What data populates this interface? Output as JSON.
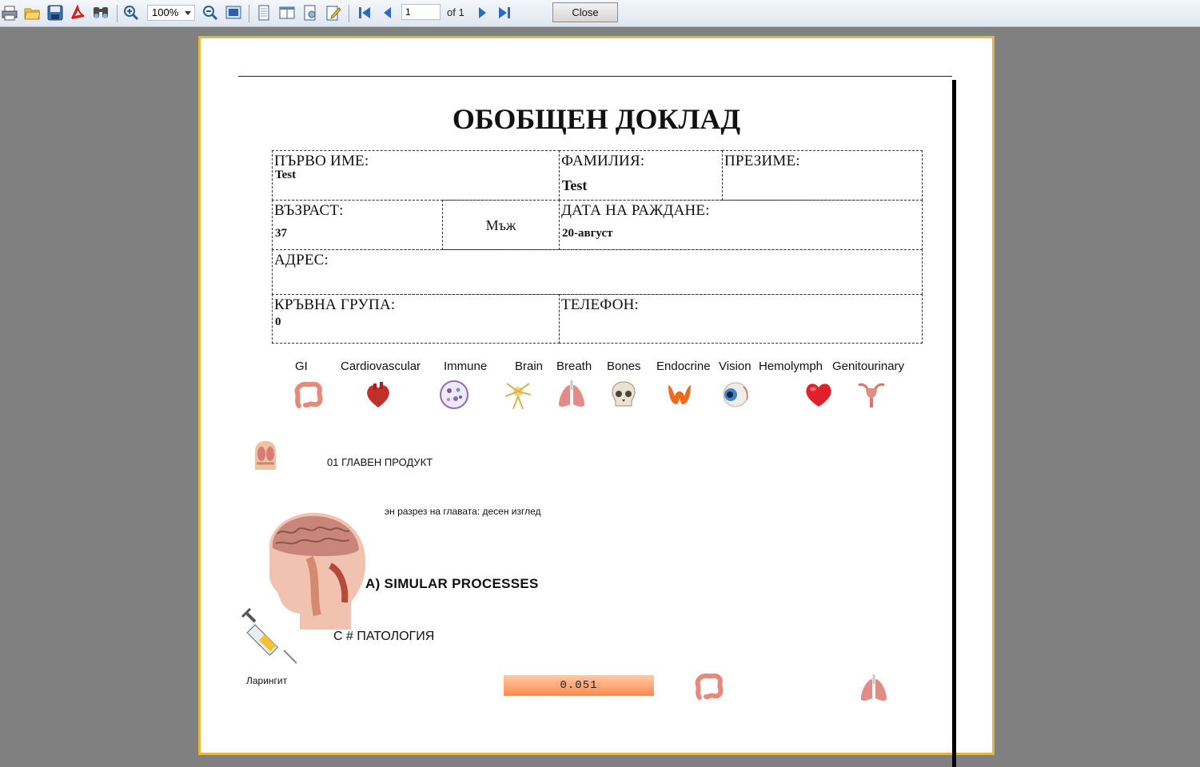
{
  "toolbar": {
    "zoom_value": "100%",
    "page_number": "1",
    "page_of": "of 1",
    "close_label": "Close"
  },
  "report": {
    "title": "ОБОБЩЕН ДОКЛАД",
    "first_name_label": "ПЪРВО ИМЕ:",
    "first_name_value": "Test",
    "last_name_label": "ФАМИЛИЯ:",
    "last_name_value": "Test",
    "patronymic_label": "ПРЕЗИМЕ:",
    "age_label": "ВЪЗРАСТ:",
    "age_value": "37",
    "sex_value": "Мъж",
    "birth_date_label": "ДАТА НА РАЖДАНЕ:",
    "birth_date_value": "20-август",
    "address_label": "АДРЕС:",
    "blood_group_label": "КРЪВНА ГРУПА:",
    "blood_group_value": "0",
    "phone_label": "ТЕЛЕФОН:"
  },
  "categories": [
    "GI",
    "Cardiovascular",
    "Immune",
    "Brain",
    "Breath",
    "Bones",
    "Endocrine",
    "Vision",
    "Hemolymph",
    "Genitourinary"
  ],
  "section": {
    "main_product": "01 ГЛАВЕН ПРОДУКТ",
    "head_section": "эн разрез на главата: десен изглед",
    "similar_processes": "A) SIMULAR PROCESSES",
    "pathology": "C # ПАТОЛОГИЯ",
    "diagnosis": "Ларингит",
    "score": 0.051,
    "score_text": "0.051"
  }
}
